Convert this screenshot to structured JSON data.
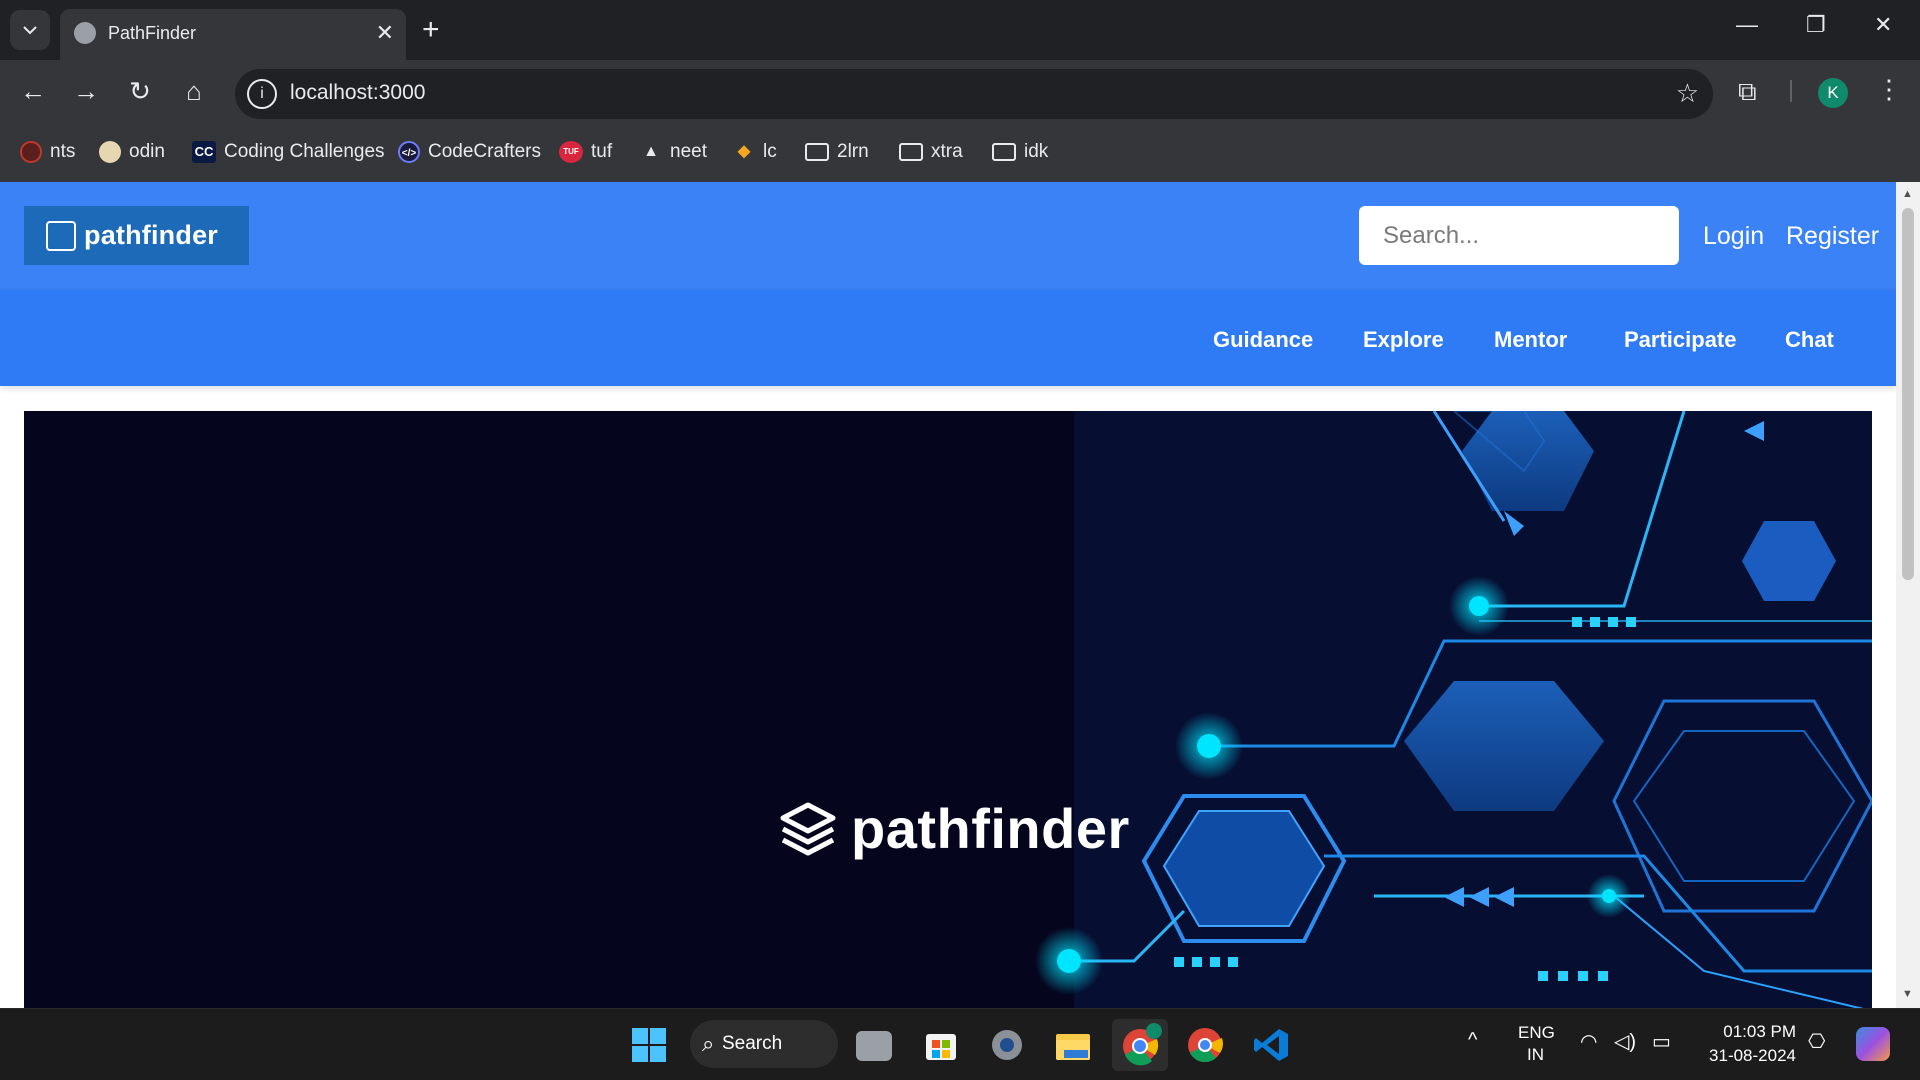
{
  "browser": {
    "tab_title": "PathFinder",
    "url": "localhost:3000",
    "profile_initial": "K",
    "bookmarks": [
      {
        "label": "nts",
        "icon": "nts-icon"
      },
      {
        "label": "odin",
        "icon": "odin-icon"
      },
      {
        "label": "Coding Challenges",
        "icon": "cc-icon",
        "icon_text": "CC"
      },
      {
        "label": "CodeCrafters",
        "icon": "codecrafters-icon"
      },
      {
        "label": "tuf",
        "icon": "tuf-icon",
        "icon_text": "TUF"
      },
      {
        "label": "neet",
        "icon": "neet-icon"
      },
      {
        "label": "lc",
        "icon": "leetcode-icon"
      },
      {
        "label": "2lrn",
        "icon": "folder-icon"
      },
      {
        "label": "xtra",
        "icon": "folder-icon"
      },
      {
        "label": "idk",
        "icon": "folder-icon"
      }
    ]
  },
  "site": {
    "logo_text": "pathfinder",
    "search_placeholder": "Search...",
    "login": "Login",
    "register": "Register",
    "nav": [
      "Guidance",
      "Explore",
      "Mentor",
      "Participate",
      "Chat"
    ],
    "hero_logo_text": "pathfinder"
  },
  "taskbar": {
    "search_label": "Search",
    "lang_line1": "ENG",
    "lang_line2": "IN",
    "time": "01:03 PM",
    "date": "31-08-2024"
  },
  "colors": {
    "header_blue": "#3b82f6",
    "nav_blue": "#2f7af5",
    "hero_bg": "#05061e",
    "accent_cyan": "#00e5ff"
  }
}
